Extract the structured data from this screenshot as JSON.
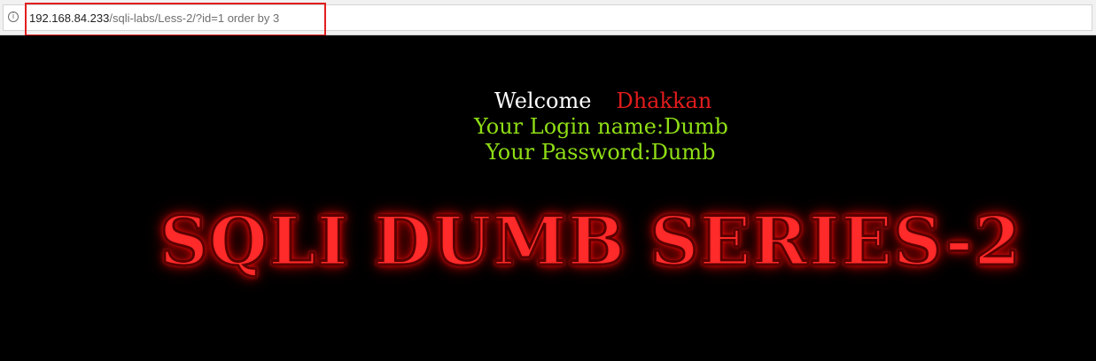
{
  "browser": {
    "url_host": "192.168.84.233",
    "url_path": "/sqli-labs/Less-2/?id=1 order by 3",
    "info_icon": "i"
  },
  "page": {
    "welcome_label": "Welcome",
    "welcome_name": "Dhakkan",
    "login_text": "Your Login name:Dumb",
    "password_text": "Your Password:Dumb",
    "title_image_text": "SQLI DUMB SERIES-2"
  }
}
